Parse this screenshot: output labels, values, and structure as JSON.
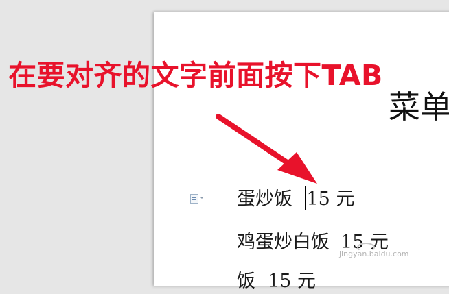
{
  "annotation": {
    "text": "在要对齐的文字前面按下TAB"
  },
  "document": {
    "title": "菜单",
    "lines": [
      {
        "item": "蛋炒饭",
        "price": "15 元",
        "has_caret": true
      },
      {
        "item": "鸡蛋炒白饭",
        "price": "15 元"
      },
      {
        "item": "饭",
        "price": "15 元"
      }
    ]
  },
  "watermark": {
    "text": "jingyan.baidu.com"
  },
  "colors": {
    "annotation": "#e8122b",
    "workspace": "#e6e6e6",
    "page": "#ffffff"
  }
}
